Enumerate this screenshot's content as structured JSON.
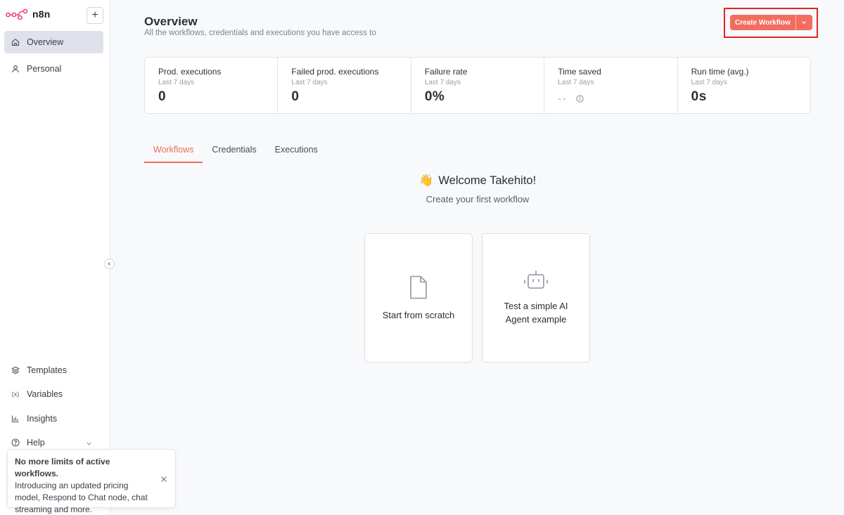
{
  "app": {
    "name": "n8n"
  },
  "sidebar": {
    "add_label": "+",
    "nav_top": [
      {
        "label": "Overview",
        "icon": "home-icon",
        "active": true
      },
      {
        "label": "Personal",
        "icon": "user-icon",
        "active": false
      }
    ],
    "nav_bottom": [
      {
        "label": "Templates",
        "icon": "templates-icon"
      },
      {
        "label": "Variables",
        "icon": "variables-icon"
      },
      {
        "label": "Insights",
        "icon": "insights-icon"
      },
      {
        "label": "Help",
        "icon": "help-icon"
      }
    ]
  },
  "toast": {
    "title": "No more limits of active workflows.",
    "body": "Introducing an updated pricing model, Respond to Chat node, chat streaming and more."
  },
  "header": {
    "title": "Overview",
    "subtitle": "All the workflows, credentials and executions you have access to",
    "create_label": "Create Workflow"
  },
  "stats": [
    {
      "label": "Prod. executions",
      "period": "Last 7 days",
      "value": "0"
    },
    {
      "label": "Failed prod. executions",
      "period": "Last 7 days",
      "value": "0"
    },
    {
      "label": "Failure rate",
      "period": "Last 7 days",
      "value": "0%"
    },
    {
      "label": "Time saved",
      "period": "Last 7 days",
      "value": "--"
    },
    {
      "label": "Run time (avg.)",
      "period": "Last 7 days",
      "value": "0s"
    }
  ],
  "tabs": [
    {
      "label": "Workflows",
      "active": true
    },
    {
      "label": "Credentials",
      "active": false
    },
    {
      "label": "Executions",
      "active": false
    }
  ],
  "welcome": {
    "emoji": "👋",
    "title": "Welcome Takehito!",
    "subtitle": "Create your first workflow"
  },
  "cards": [
    {
      "label": "Start from scratch",
      "icon": "file-icon"
    },
    {
      "label_line1": "Test a simple AI",
      "label_line2": "Agent example",
      "icon": "robot-icon"
    }
  ],
  "colors": {
    "accent": "#ee6b5c",
    "highlight": "#e0242a"
  }
}
